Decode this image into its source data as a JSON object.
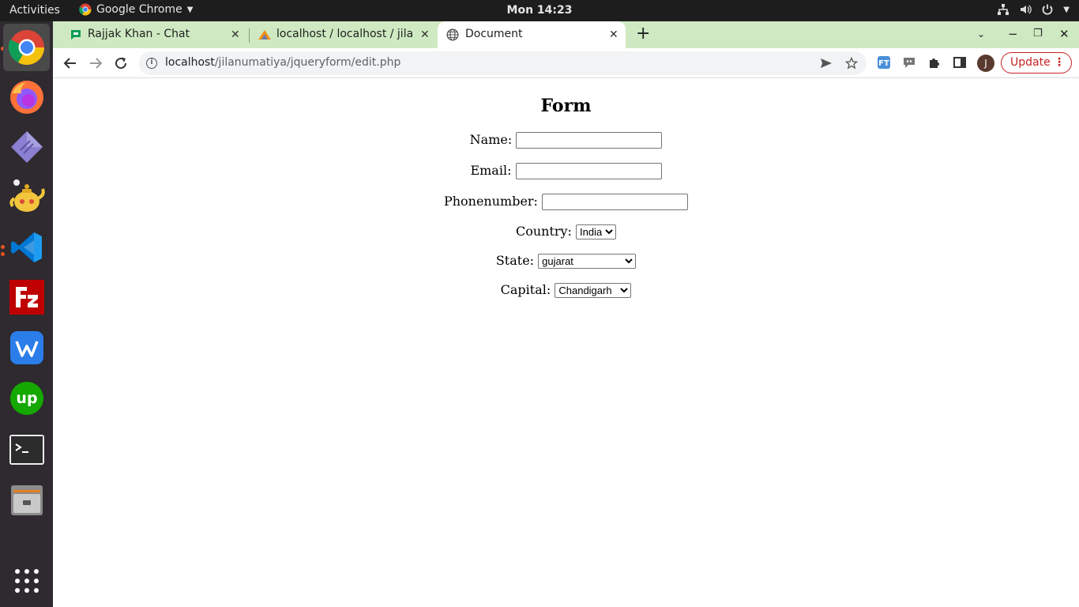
{
  "topbar": {
    "activities": "Activities",
    "app_name": "Google Chrome",
    "clock": "Mon 14:23"
  },
  "dock": {
    "items": [
      "chrome-icon",
      "firefox-icon",
      "code-editor-icon",
      "teapot-icon",
      "vscode-icon",
      "filezilla-icon",
      "wps-icon",
      "upwork-icon",
      "terminal-icon",
      "files-icon",
      "app-grid-icon"
    ]
  },
  "tabs": [
    {
      "title": "Rajjak Khan - Chat",
      "icon": "chat-icon"
    },
    {
      "title": "localhost / localhost / jilar",
      "icon": "phpmyadmin-icon"
    },
    {
      "title": "Document",
      "icon": "globe-icon",
      "active": true
    }
  ],
  "toolbar": {
    "url_host": "localhost",
    "url_path": "/jilanumatiya/jqueryform/edit.php",
    "profile_initial": "J",
    "update_label": "Update"
  },
  "form": {
    "title": "Form",
    "name_label": "Name:",
    "name_value": "",
    "email_label": "Email:",
    "email_value": "",
    "phone_label": "Phonenumber:",
    "phone_value": "",
    "country_label": "Country:",
    "country_selected": "India",
    "state_label": "State:",
    "state_selected": "gujarat",
    "capital_label": "Capital:",
    "capital_selected": "Chandigarh"
  }
}
